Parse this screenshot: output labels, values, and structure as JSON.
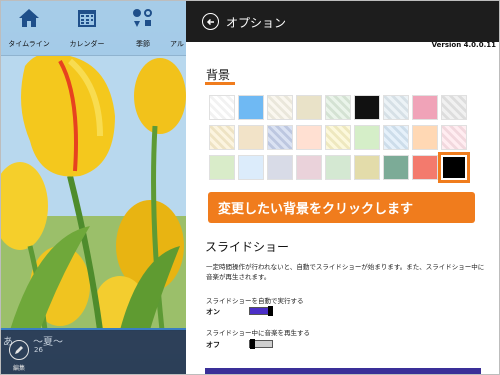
{
  "app": {
    "nav": [
      {
        "label": "タイムライン",
        "icon": "home-icon"
      },
      {
        "label": "カレンダー",
        "icon": "calendar-icon"
      },
      {
        "label": "季節",
        "icon": "seasons-icon"
      },
      {
        "label": "アル",
        "icon": "album-icon"
      }
    ],
    "title": "あ　　〜夏〜",
    "date": "26",
    "edit_label": "編集"
  },
  "options": {
    "title": "オプション",
    "version": "Version 4.0.0.11",
    "background_heading": "背景",
    "swatches": [
      [
        "#ffffff",
        "#6fb9f3",
        "#f7f3e7",
        "#e9e2c8",
        "#dfeede",
        "#111111",
        "#e2ecf2",
        "#f0a3b8",
        "#e9e9e9"
      ],
      [
        "#fbefcf",
        "#f2e3c8",
        "#c7d2ec",
        "#ffe0d2",
        "#fbf4c9",
        "#d5eec8",
        "#d8e9f7",
        "#ffd8b4",
        "#ffe4ea"
      ],
      [
        "#d9ecc9",
        "#dcecfb",
        "#d8dbe7",
        "#ead2da",
        "#d4e8d2",
        "#e3dcaa",
        "#7cab97",
        "#f37a6d",
        "#000000"
      ]
    ],
    "selected_swatch": "black",
    "callout": "変更したい背景をクリックします",
    "slideshow_heading": "スライドショー",
    "slideshow_desc": "一定時間操作が行われないと、自動でスライドショーが始まります。また、スライドショー中に音楽が再生されます。",
    "autoplay_label": "スライドショーを自動で実行する",
    "autoplay_state": "オン",
    "music_label": "スライドショー中に音楽を再生する",
    "music_state": "オフ"
  },
  "colors": {
    "accent": "#f07c1d",
    "header": "#1d1d1d",
    "toggle_on": "#4b2fc7"
  }
}
